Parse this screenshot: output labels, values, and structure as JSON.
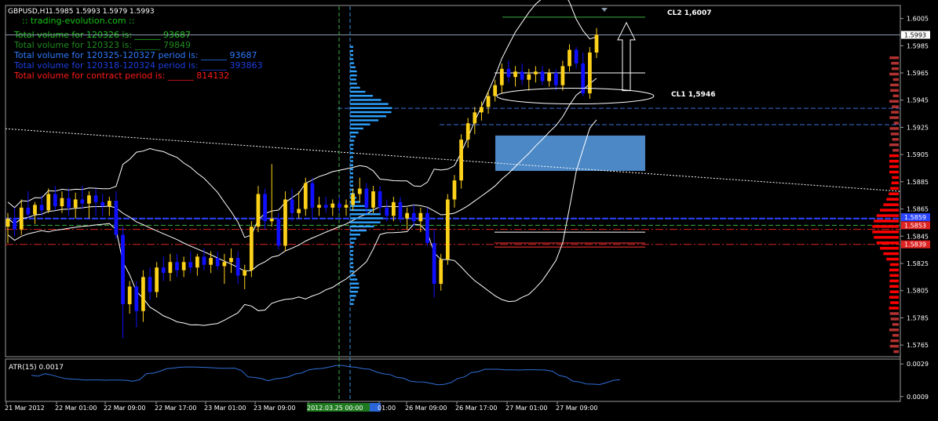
{
  "header": {
    "symbol": "GBPUSD,H1",
    "ohlc": "1.5985 1.5993 1.5979 1.5993",
    "watermark": ":: trading-evolution.com ::"
  },
  "volume_lines": [
    {
      "label": "Total volume for 120326 is: ______",
      "value": "93687",
      "color": "#22c322"
    },
    {
      "label": "Total volume for 120323 is: ______",
      "value": "79849",
      "color": "#1f8a1f"
    },
    {
      "label": "Total volume for 120325-120327 period is: ______",
      "value": "93687",
      "color": "#2d7bff"
    },
    {
      "label": "Total volume for 120318-120324 period is: ______",
      "value": "393863",
      "color": "#1d3fe0"
    },
    {
      "label": "Total volume for contract period is: ______",
      "value": "814132",
      "color": "#ff1a1a"
    }
  ],
  "annotations": {
    "cl2": "CL2 1,6007",
    "cl1": "CL1 1,5946"
  },
  "atr": {
    "label": "ATR(15) 0.0017",
    "ticks": [
      "0.0029",
      "0.0009"
    ]
  },
  "colors": {
    "bull": "#ffd21a",
    "bear": "#1010ff",
    "bands": "#ffffff",
    "atr_line": "#2f6fd6",
    "profile": "#2fa2ff",
    "volume_red": "#ff0000",
    "volume_darkred": "#b23232",
    "zone": "#4f8fd0"
  },
  "chart_data": {
    "type": "candlestick",
    "symbol": "GBPUSD",
    "timeframe": "H1",
    "price_axis_ticks": [
      "1.6005",
      "1.5985",
      "1.5965",
      "1.5945",
      "1.5925",
      "1.5905",
      "1.5885",
      "1.5865",
      "1.5845",
      "1.5825",
      "1.5805",
      "1.5785",
      "1.5765"
    ],
    "price_axis_markers": [
      "1.5993",
      "1.5859",
      "1.5853",
      "1.5839"
    ],
    "ylim": [
      1.5757,
      1.6014
    ],
    "time_axis_ticks": [
      "21 Mar 2012",
      "22 Mar 01:00",
      "22 Mar 09:00",
      "22 Mar 17:00",
      "23 Mar 01:00",
      "23 Mar 09:00",
      "2012.03.25 00:00",
      "01:00",
      "26 Mar 09:00",
      "26 Mar 17:00",
      "27 Mar 01:00",
      "27 Mar 09:00"
    ],
    "candles": [
      [
        1.5852,
        1.5862,
        1.584,
        1.5858
      ],
      [
        1.5858,
        1.5866,
        1.5845,
        1.585
      ],
      [
        1.585,
        1.5872,
        1.5846,
        1.5866
      ],
      [
        1.5866,
        1.5878,
        1.5858,
        1.5861
      ],
      [
        1.5861,
        1.587,
        1.5854,
        1.5868
      ],
      [
        1.5868,
        1.5875,
        1.586,
        1.5864
      ],
      [
        1.5864,
        1.588,
        1.5862,
        1.5876
      ],
      [
        1.5876,
        1.5882,
        1.5864,
        1.5867
      ],
      [
        1.5867,
        1.5878,
        1.5862,
        1.5873
      ],
      [
        1.5873,
        1.588,
        1.586,
        1.5866
      ],
      [
        1.5866,
        1.5877,
        1.5858,
        1.5872
      ],
      [
        1.5872,
        1.5882,
        1.5865,
        1.5869
      ],
      [
        1.5869,
        1.5878,
        1.5858,
        1.5875
      ],
      [
        1.5875,
        1.588,
        1.586,
        1.587
      ],
      [
        1.587,
        1.5876,
        1.586,
        1.5867
      ],
      [
        1.5867,
        1.5874,
        1.586,
        1.5871
      ],
      [
        1.5871,
        1.5878,
        1.5843,
        1.5846
      ],
      [
        1.5846,
        1.5852,
        1.577,
        1.5795
      ],
      [
        1.5795,
        1.5812,
        1.5788,
        1.5808
      ],
      [
        1.5808,
        1.5812,
        1.5778,
        1.579
      ],
      [
        1.579,
        1.582,
        1.5782,
        1.5815
      ],
      [
        1.5815,
        1.5822,
        1.5798,
        1.5804
      ],
      [
        1.5804,
        1.5826,
        1.58,
        1.5822
      ],
      [
        1.5822,
        1.583,
        1.5812,
        1.5818
      ],
      [
        1.5818,
        1.5832,
        1.5812,
        1.5826
      ],
      [
        1.5826,
        1.5832,
        1.5815,
        1.582
      ],
      [
        1.582,
        1.583,
        1.5815,
        1.5826
      ],
      [
        1.5826,
        1.5834,
        1.5818,
        1.5822
      ],
      [
        1.5822,
        1.5832,
        1.5816,
        1.583
      ],
      [
        1.583,
        1.5836,
        1.582,
        1.5824
      ],
      [
        1.5824,
        1.5834,
        1.5818,
        1.5829
      ],
      [
        1.5829,
        1.5834,
        1.582,
        1.5823
      ],
      [
        1.5823,
        1.5832,
        1.581,
        1.5826
      ],
      [
        1.5826,
        1.5836,
        1.5818,
        1.5829
      ],
      [
        1.5829,
        1.5834,
        1.581,
        1.5816
      ],
      [
        1.5816,
        1.5824,
        1.5806,
        1.582
      ],
      [
        1.582,
        1.5856,
        1.5815,
        1.5852
      ],
      [
        1.5852,
        1.5882,
        1.5848,
        1.5876
      ],
      [
        1.5876,
        1.588,
        1.585,
        1.5856
      ],
      [
        1.5856,
        1.5898,
        1.5852,
        1.5858
      ],
      [
        1.5858,
        1.5862,
        1.5835,
        1.5838
      ],
      [
        1.5838,
        1.5878,
        1.5834,
        1.5872
      ],
      [
        1.5872,
        1.588,
        1.5856,
        1.5862
      ],
      [
        1.5862,
        1.5878,
        1.5858,
        1.5865
      ],
      [
        1.5865,
        1.5888,
        1.586,
        1.5884
      ],
      [
        1.5884,
        1.5888,
        1.5858,
        1.5866
      ],
      [
        1.5866,
        1.5874,
        1.586,
        1.5868
      ],
      [
        1.5868,
        1.5874,
        1.5862,
        1.5866
      ],
      [
        1.5866,
        1.5872,
        1.586,
        1.5869
      ],
      [
        1.5869,
        1.5874,
        1.5862,
        1.5866
      ],
      [
        1.5866,
        1.5872,
        1.586,
        1.5868
      ],
      [
        1.5868,
        1.588,
        1.5864,
        1.5876
      ],
      [
        1.5876,
        1.5888,
        1.587,
        1.588
      ],
      [
        1.588,
        1.5884,
        1.5862,
        1.5866
      ],
      [
        1.5866,
        1.5882,
        1.5862,
        1.5878
      ],
      [
        1.5878,
        1.5882,
        1.5862,
        1.5866
      ],
      [
        1.5866,
        1.5872,
        1.5856,
        1.586
      ],
      [
        1.586,
        1.5874,
        1.5856,
        1.587
      ],
      [
        1.587,
        1.5874,
        1.5855,
        1.5858
      ],
      [
        1.5858,
        1.5866,
        1.585,
        1.5862
      ],
      [
        1.5862,
        1.5868,
        1.5852,
        1.5856
      ],
      [
        1.5856,
        1.5866,
        1.5848,
        1.5862
      ],
      [
        1.5862,
        1.5866,
        1.5838,
        1.584
      ],
      [
        1.584,
        1.585,
        1.58,
        1.581
      ],
      [
        1.581,
        1.5832,
        1.5805,
        1.5828
      ],
      [
        1.5828,
        1.5876,
        1.5824,
        1.5872
      ],
      [
        1.5872,
        1.589,
        1.5866,
        1.5886
      ],
      [
        1.5886,
        1.592,
        1.588,
        1.5916
      ],
      [
        1.5916,
        1.5932,
        1.591,
        1.5928
      ],
      [
        1.5928,
        1.594,
        1.592,
        1.5936
      ],
      [
        1.5936,
        1.5944,
        1.593,
        1.594
      ],
      [
        1.594,
        1.5952,
        1.5935,
        1.5948
      ],
      [
        1.5948,
        1.596,
        1.5944,
        1.5956
      ],
      [
        1.5956,
        1.5972,
        1.595,
        1.5968
      ],
      [
        1.5968,
        1.5974,
        1.5958,
        1.5962
      ],
      [
        1.5962,
        1.597,
        1.5955,
        1.5966
      ],
      [
        1.5966,
        1.5972,
        1.5956,
        1.596
      ],
      [
        1.596,
        1.5968,
        1.5952,
        1.5964
      ],
      [
        1.5964,
        1.597,
        1.5958,
        1.5966
      ],
      [
        1.5966,
        1.597,
        1.5956,
        1.5959
      ],
      [
        1.5959,
        1.5968,
        1.5955,
        1.5965
      ],
      [
        1.5965,
        1.5968,
        1.5952,
        1.5956
      ],
      [
        1.5956,
        1.5974,
        1.5952,
        1.597
      ],
      [
        1.597,
        1.5986,
        1.5966,
        1.5982
      ],
      [
        1.5982,
        1.5984,
        1.5968,
        1.5972
      ],
      [
        1.5972,
        1.598,
        1.5948,
        1.595
      ],
      [
        1.595,
        1.5984,
        1.5946,
        1.598
      ],
      [
        1.598,
        1.5998,
        1.5976,
        1.5993
      ]
    ]
  }
}
